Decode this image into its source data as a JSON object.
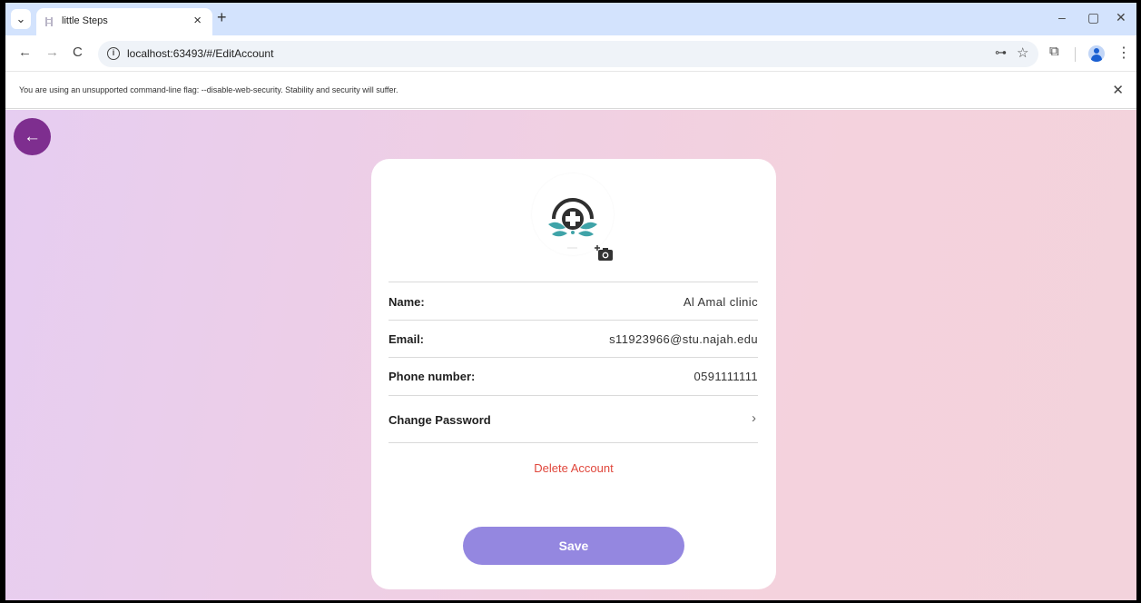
{
  "browser": {
    "tab_title": "little Steps",
    "tab_close": "×",
    "new_tab": "+",
    "url": "localhost:63493/#/EditAccount",
    "minimize": "–",
    "restore": "▢",
    "close": "✕",
    "back": "←",
    "forward": "→",
    "reload": "C",
    "info": "i",
    "key": "⊶",
    "star": "☆",
    "extensions": "⧉",
    "menu": "⋮",
    "dropdown": "⌄"
  },
  "infobar": {
    "message": "You are using an unsupported command-line flag: --disable-web-security. Stability and security will suffer.",
    "close": "✕"
  },
  "app": {
    "back_icon": "←",
    "name_label": "Name:",
    "name_value": "Al Amal clinic",
    "email_label": "Email:",
    "email_value": "s11923966@stu.najah.edu",
    "phone_label": "Phone number:",
    "phone_value": "0591111111",
    "change_password": "Change Password",
    "chevron": "›",
    "delete_account": "Delete Account",
    "save": "Save",
    "colors": {
      "accent": "#7e2e8f",
      "save_button": "#9487e0",
      "delete": "#e0473c",
      "logo_teal": "#3fa3a8"
    },
    "icons": [
      "arrow-left-icon",
      "clinic-logo-icon",
      "add-photo-icon",
      "chevron-right-icon"
    ]
  }
}
